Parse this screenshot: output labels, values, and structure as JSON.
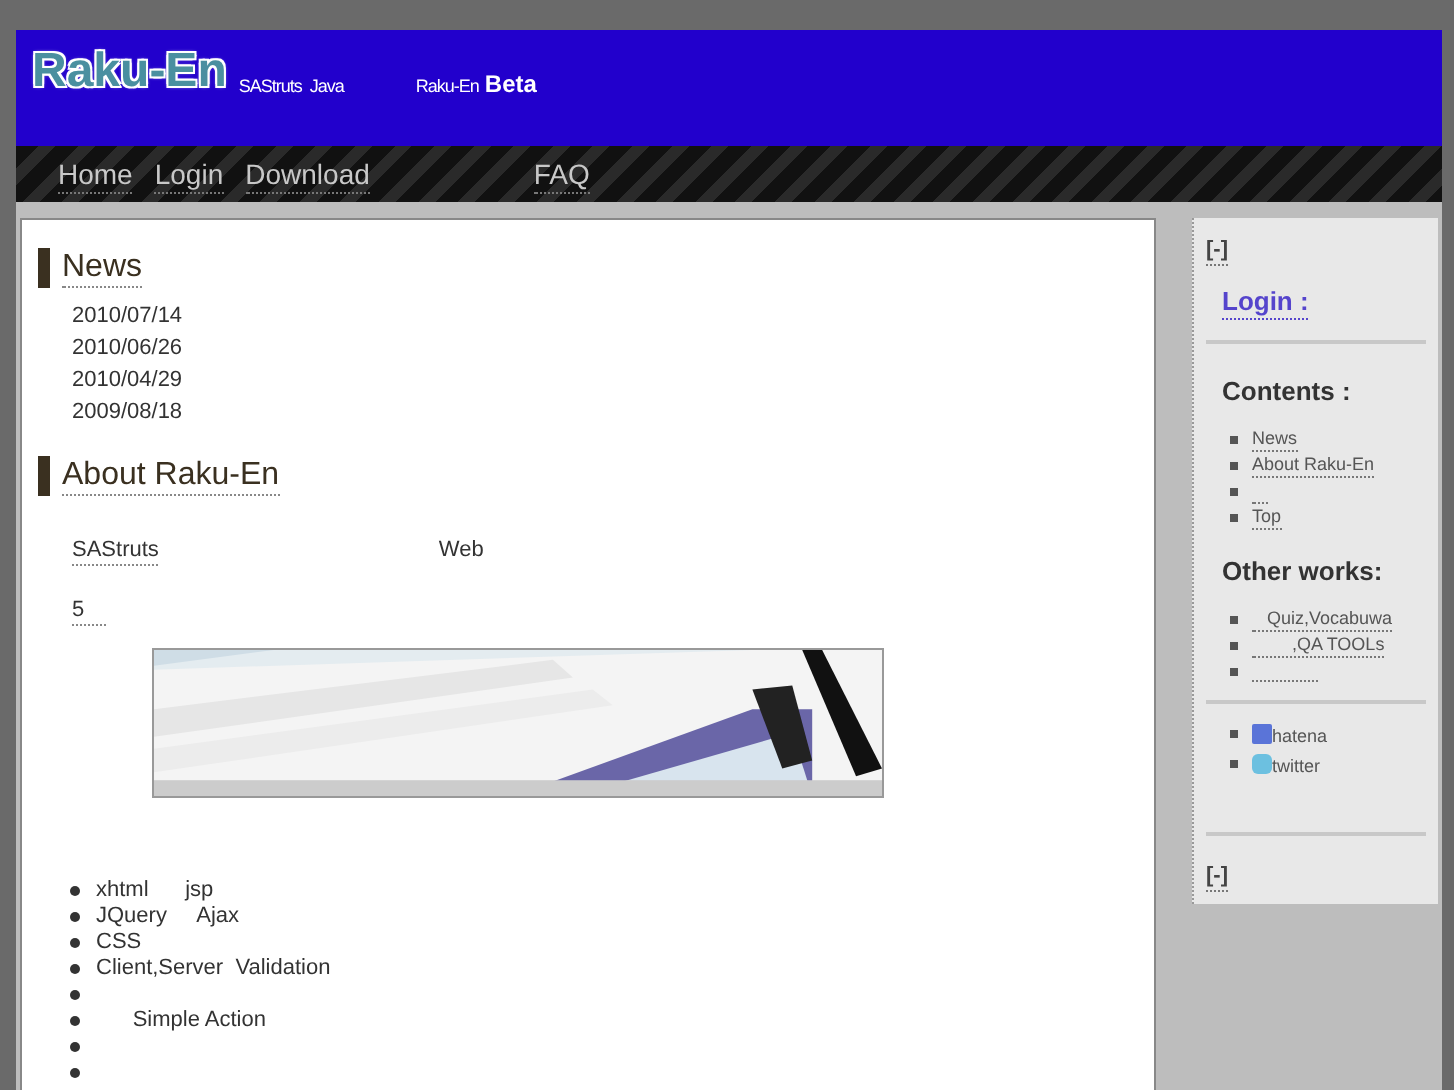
{
  "header": {
    "logo": "Raku-En",
    "tagline_1": "SAStruts  Java",
    "tagline_2": "Raku-En",
    "tagline_badge": "Beta"
  },
  "nav": [
    {
      "label": "Home",
      "kind": "link"
    },
    {
      "label": "Login",
      "kind": "link"
    },
    {
      "label": "Download",
      "kind": "link"
    },
    {
      "kind": "gap"
    },
    {
      "label": "FAQ",
      "kind": "link"
    }
  ],
  "news": {
    "title": "News",
    "dates": [
      "2010/07/14",
      "2010/06/26",
      "2010/04/29",
      "2009/08/18"
    ]
  },
  "about": {
    "title": "About Raku-En",
    "intro_link": "SAStruts",
    "intro_text": "Web",
    "count_link": "5",
    "features": [
      {
        "kind": "text",
        "text": "xhtml      jsp"
      },
      {
        "kind": "text",
        "text": "JQuery     Ajax"
      },
      {
        "kind": "text",
        "text": "CSS"
      },
      {
        "kind": "text",
        "text": "Client,Server  Validation"
      },
      {
        "kind": "blank"
      },
      {
        "kind": "text",
        "text": "      Simple Action"
      },
      {
        "kind": "blank"
      },
      {
        "kind": "blank"
      }
    ]
  },
  "sidebar": {
    "toggle_top": "[-]",
    "login": "Login :",
    "contents_title": "Contents :",
    "contents": [
      {
        "kind": "link",
        "text": "News"
      },
      {
        "kind": "link",
        "text": "About Raku-En"
      },
      {
        "kind": "blank"
      },
      {
        "kind": "link",
        "text": "Top"
      }
    ],
    "other_title": "Other works:",
    "other": [
      {
        "kind": "link",
        "text": "   Quiz,Vocabuwa"
      },
      {
        "kind": "link",
        "text": "        ,QA TOOLs"
      },
      {
        "kind": "blank"
      }
    ],
    "social": [
      {
        "kind": "hatena",
        "text": "hatena"
      },
      {
        "kind": "twitter",
        "text": "twitter"
      }
    ],
    "toggle_bottom": "[-]"
  }
}
